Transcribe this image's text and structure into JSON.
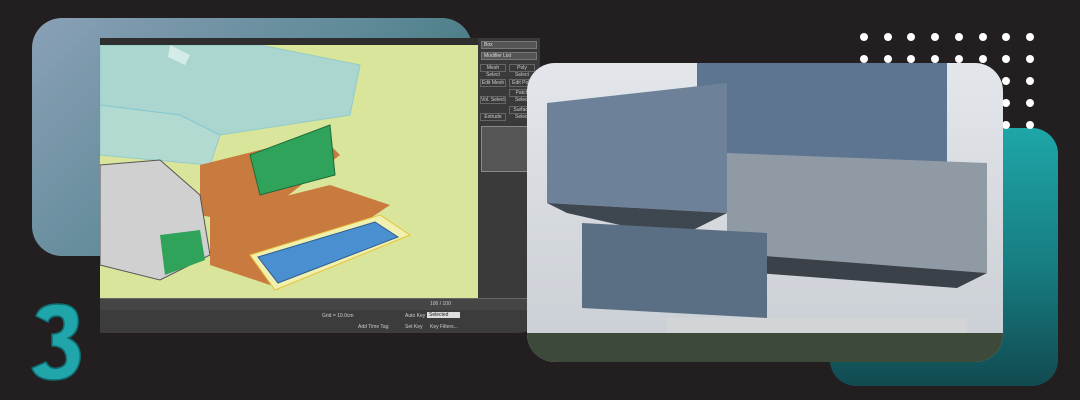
{
  "app_panel": {
    "object_name": "Box",
    "modifier_list": "Modifier List",
    "buttons": [
      "Mesh Select",
      "Poly Select",
      "Edit Mesh",
      "Edit Poly",
      "Vol. Select",
      "Patch Select",
      "Extrude",
      "Surface Select"
    ]
  },
  "timeline": {
    "frame_counter": "100 / 100"
  },
  "status_bar": {
    "grid": "Grid = 10.0cm",
    "add_time_tag": "Add Time Tag",
    "auto_key": "Auto Key",
    "set_key": "Set Key",
    "selected": "Selected",
    "key_filters": "Key Filters..."
  },
  "colors": {
    "background": "#231f20",
    "teal": "#1ea6a8",
    "viewport": "#d9e59a"
  }
}
